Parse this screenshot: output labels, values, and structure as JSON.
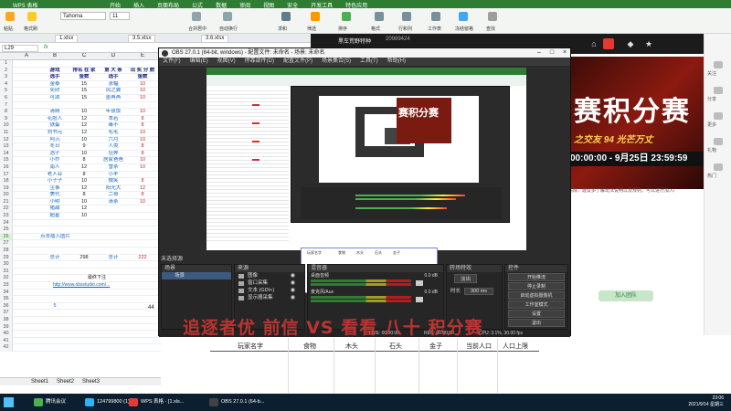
{
  "wps": {
    "app_name": "WPS 表格",
    "menus": [
      "开始",
      "插入",
      "页面布局",
      "公式",
      "数据",
      "审阅",
      "视图",
      "安全",
      "开发工具",
      "特色应用"
    ],
    "font_name": "Tahoma",
    "font_size": "11",
    "ribbon_labels": [
      "粘贴",
      "格式刷",
      "合并居中",
      "自动换行",
      "求和",
      "筛选",
      "排序",
      "格式",
      "行和列",
      "工作表",
      "冻结窗格",
      "查找"
    ],
    "tabs": [
      "1.xlsx",
      "3.5.xlsx",
      "3.6.xlsx"
    ],
    "cell_ref": "L29",
    "fx": "fx",
    "columns": [
      "A",
      "B",
      "C",
      "D",
      "E"
    ],
    "rows": [
      {
        "n": "1",
        "b": "",
        "c": "",
        "d": "",
        "e": ""
      },
      {
        "n": "2",
        "b": "游戏",
        "c": "排名 在 家",
        "d": "第 大 条",
        "e": "出 奖 分 数"
      },
      {
        "n": "3",
        "b": "选手",
        "c": "金数",
        "d": "选手",
        "e": "金数"
      },
      {
        "n": "4",
        "b": "金泰",
        "c": "15",
        "d": "涨幅",
        "e": "10"
      },
      {
        "n": "5",
        "b": "奕欣",
        "c": "15",
        "d": "风之翼",
        "e": "10"
      },
      {
        "n": "6",
        "b": "可颂",
        "c": "15",
        "d": "墨苒苒",
        "e": "10"
      },
      {
        "n": "7",
        "b": "",
        "c": "",
        "d": "",
        "e": ""
      },
      {
        "n": "8",
        "b": "清晴",
        "c": "10",
        "d": "年夜饭",
        "e": "10"
      },
      {
        "n": "9",
        "b": "花脸人",
        "c": "12",
        "d": "本若",
        "e": "8"
      },
      {
        "n": "10",
        "b": "铁蛋",
        "c": "12",
        "d": "毒不",
        "e": "8"
      },
      {
        "n": "11",
        "b": "刘书元",
        "c": "12",
        "d": "毛毛",
        "e": "10"
      },
      {
        "n": "12",
        "b": "阿沉",
        "c": "10",
        "d": "六月",
        "e": "10"
      },
      {
        "n": "13",
        "b": "冬日",
        "c": "9",
        "d": "人类",
        "e": "8"
      },
      {
        "n": "14",
        "b": "浩子",
        "c": "10",
        "d": "狂奔",
        "e": "8"
      },
      {
        "n": "15",
        "b": "小乔",
        "c": "8",
        "d": "居家爸爸",
        "e": "10"
      },
      {
        "n": "16",
        "b": "南人",
        "c": "12",
        "d": "雪茶",
        "e": "10"
      },
      {
        "n": "17",
        "b": "老人亚",
        "c": "8",
        "d": "小羊",
        "e": ""
      },
      {
        "n": "18",
        "b": "小子子",
        "c": "10",
        "d": "微笑",
        "e": "8"
      },
      {
        "n": "19",
        "b": "尘事",
        "c": "12",
        "d": "阳光大",
        "e": "12"
      },
      {
        "n": "20",
        "b": "美代",
        "c": "8",
        "d": "二哥",
        "e": "8"
      },
      {
        "n": "21",
        "b": "小明",
        "c": "10",
        "d": "清茶",
        "e": "10"
      },
      {
        "n": "22",
        "b": "猪甜",
        "c": "12",
        "d": "",
        "e": ""
      },
      {
        "n": "23",
        "b": "超星",
        "c": "10",
        "d": "",
        "e": ""
      },
      {
        "n": "24",
        "b": "",
        "c": "",
        "d": "",
        "e": ""
      },
      {
        "n": "25",
        "b": "",
        "c": "",
        "d": "",
        "e": ""
      },
      {
        "n": "26",
        "b": "点击插入图片",
        "c": "",
        "d": "",
        "e": ""
      },
      {
        "n": "27",
        "b": "",
        "c": "",
        "d": "",
        "e": ""
      },
      {
        "n": "28",
        "b": "",
        "c": "",
        "d": "",
        "e": ""
      },
      {
        "n": "29",
        "b": "总计",
        "c": "298",
        "d": "总计",
        "e": "222"
      },
      {
        "n": "30",
        "b": "",
        "c": "",
        "d": "",
        "e": ""
      },
      {
        "n": "31",
        "b": "",
        "c": "",
        "d": "",
        "e": ""
      },
      {
        "n": "32",
        "b": "",
        "c": "",
        "d": "",
        "e": ""
      },
      {
        "n": "33",
        "b": "",
        "c": "",
        "d": "",
        "e": ""
      },
      {
        "n": "34",
        "b": "",
        "c": "",
        "d": "",
        "e": ""
      },
      {
        "n": "35",
        "b": "",
        "c": "",
        "d": "",
        "e": ""
      },
      {
        "n": "36",
        "b": "5",
        "c": "",
        "d": "",
        "e": ""
      },
      {
        "n": "37",
        "b": "",
        "c": "",
        "d": "",
        "e": ""
      },
      {
        "n": "38",
        "b": "",
        "c": "",
        "d": "",
        "e": ""
      },
      {
        "n": "39",
        "b": "",
        "c": "",
        "d": "",
        "e": ""
      },
      {
        "n": "40",
        "b": "",
        "c": "",
        "d": "",
        "e": ""
      },
      {
        "n": "41",
        "b": "",
        "c": "",
        "d": "",
        "e": ""
      },
      {
        "n": "42",
        "b": "",
        "c": "",
        "d": "",
        "e": ""
      }
    ],
    "link_text": "http://www.obsstudio.com/...",
    "link_label": "最终下注",
    "far_value": "44",
    "sheet_tabs": [
      "Sheet1",
      "Sheet2",
      "Sheet3"
    ]
  },
  "stream": {
    "user": "黑车荒野特种",
    "number": "20989424",
    "banner_big": "赛积分赛",
    "banner_sub": "之交友 94 光芒万丈",
    "banner_date": "00:00:00 - 9月25日 23:59:59",
    "side_labels": [
      "关注",
      "分享",
      "更多",
      "礼物",
      "热门"
    ],
    "note": "清除，建议多了解玩法说明以及规则，可以进行加入/",
    "green_btn": "加入团队",
    "lower_headers": [
      "玩家名字",
      "食物",
      "木头",
      "石头",
      "金子",
      "当前人口",
      "人口上限"
    ]
  },
  "obs": {
    "title": "OBS 27.0.1 (64-bit, windows) - 配置文件: 未命名 - 场景: 未命名",
    "menus": [
      "文件(F)",
      "编辑(E)",
      "视图(V)",
      "停靠部件(D)",
      "配置文件(P)",
      "场景集合(S)",
      "工具(T)",
      "帮助(H)"
    ],
    "no_source": "未选择源",
    "docks": {
      "scenes": "场景",
      "sources": "来源",
      "mixer": "混音器",
      "transitions": "转场特效",
      "controls": "控件"
    },
    "scenes_list": [
      "场景"
    ],
    "sources_list": [
      "图像",
      "窗口采集",
      "文本 (GDI+)",
      "显示器采集"
    ],
    "mixer": [
      {
        "name": "桌面音频",
        "db": "0.0 dB"
      },
      {
        "name": "麦克风/Aux",
        "db": "0.0 dB"
      }
    ],
    "transition": {
      "name": "淡出",
      "duration_label": "时长",
      "duration": "300 ms"
    },
    "controls": [
      "开始推流",
      "停止录制",
      "启动虚拟摄像机",
      "工作室模式",
      "设置",
      "退出"
    ],
    "status": {
      "live": "LIVE: 00:00:00",
      "rec": "REC: 00:00:00",
      "cpu": "CPU: 3.1%, 30.00 fps"
    }
  },
  "overlay_text": "追逐者优 前信 VS 看看 八十 积分赛",
  "taskbar": {
    "items": [
      "腾讯会议",
      "124799800 (1)",
      "WPS 表格 - [1.xls...",
      "OBS 27.0.1 (64-b..."
    ],
    "time": "23:06",
    "date": "2021/9/14 星期三",
    "colors": {
      "wechat": "#4caf50",
      "qq": "#29b6f6",
      "wps": "#e53935",
      "obs": "#424242"
    }
  }
}
